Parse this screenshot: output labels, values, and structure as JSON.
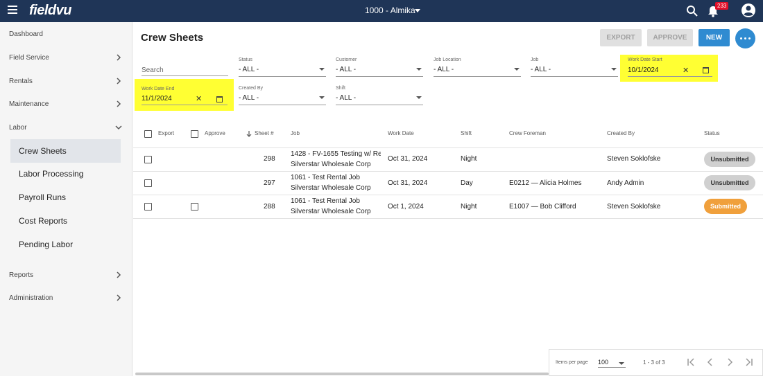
{
  "app": {
    "logo": "fieldvu",
    "company": "1000 - Almika",
    "notification_count": "233"
  },
  "sidebar": {
    "items": [
      {
        "label": "Dashboard"
      },
      {
        "label": "Field Service"
      },
      {
        "label": "Rentals"
      },
      {
        "label": "Maintenance"
      },
      {
        "label": "Labor"
      },
      {
        "label": "Reports"
      },
      {
        "label": "Administration"
      }
    ],
    "labor_sub": [
      {
        "label": "Crew Sheets"
      },
      {
        "label": "Labor Processing"
      },
      {
        "label": "Payroll Runs"
      },
      {
        "label": "Cost Reports"
      },
      {
        "label": "Pending Labor"
      }
    ]
  },
  "page": {
    "title": "Crew Sheets"
  },
  "toolbar": {
    "export_label": "EXPORT",
    "approve_label": "APPROVE",
    "new_label": "NEW"
  },
  "filters": {
    "search_placeholder": "Search",
    "status": {
      "label": "Status",
      "value": "- ALL -"
    },
    "customer": {
      "label": "Customer",
      "value": "- ALL -"
    },
    "job_location": {
      "label": "Job Location",
      "value": "- ALL -"
    },
    "job": {
      "label": "Job",
      "value": "- ALL -"
    },
    "work_date_start": {
      "label": "Work Date Start",
      "value": "10/1/2024"
    },
    "work_date_end": {
      "label": "Work Date End",
      "value": "11/1/2024"
    },
    "created_by": {
      "label": "Created By",
      "value": "- ALL -"
    },
    "shift": {
      "label": "Shift",
      "value": "- ALL -"
    }
  },
  "table": {
    "headers": {
      "export": "Export",
      "approve": "Approve",
      "sheet": "Sheet #",
      "job": "Job",
      "work_date": "Work Date",
      "shift": "Shift",
      "crew_foreman": "Crew Foreman",
      "created_by": "Created By",
      "status": "Status"
    },
    "rows": [
      {
        "sheet": "298",
        "job_line1": "1428 - FV-1655 Testing w/ Re",
        "job_line2": "Silverstar Wholesale Corp",
        "work_date": "Oct 31, 2024",
        "shift": "Night",
        "crew_foreman": "",
        "created_by": "Steven Soklofske",
        "status": "Unsubmitted"
      },
      {
        "sheet": "297",
        "job_line1": "1061 - Test Rental Job",
        "job_line2": "Silverstar Wholesale Corp",
        "work_date": "Oct 31, 2024",
        "shift": "Day",
        "crew_foreman": "E0212 — Alicia Holmes",
        "created_by": "Andy Admin",
        "status": "Unsubmitted"
      },
      {
        "sheet": "288",
        "job_line1": "1061 - Test Rental Job",
        "job_line2": "Silverstar Wholesale Corp",
        "work_date": "Oct 1, 2024",
        "shift": "Night",
        "crew_foreman": "E1007 — Bob Clifford",
        "created_by": "Steven Soklofske",
        "status": "Submitted"
      }
    ]
  },
  "pagination": {
    "items_per_page_label": "Items per page",
    "items_per_page": "100",
    "range": "1 - 3 of 3"
  },
  "colors": {
    "topbar": "#1f3557",
    "primary": "#2f8bd1",
    "highlight": "#ffff33",
    "submitted": "#f0a03c",
    "unsubmitted": "#d0d0d0"
  }
}
